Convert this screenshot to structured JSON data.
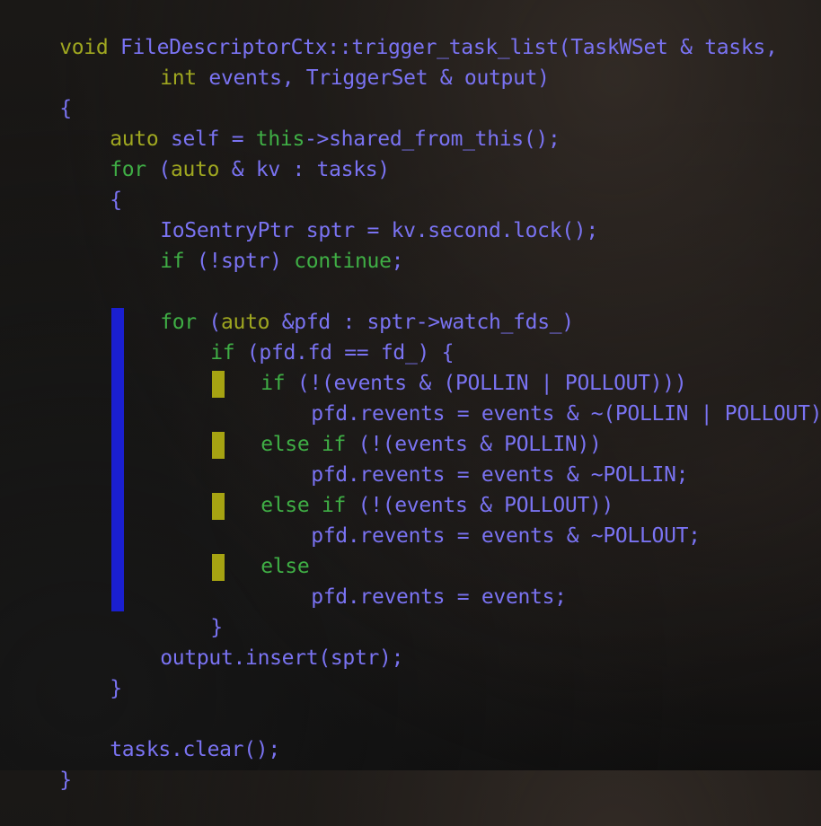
{
  "code": {
    "l1": {
      "t1": "void ",
      "t2": "FileDescriptorCtx::trigger_task_list(TaskWSet & tasks,"
    },
    "l2": {
      "t1": "int ",
      "t2": "events, TriggerSet & output)"
    },
    "l3": {
      "t2": "{"
    },
    "l4": {
      "t1": "auto ",
      "t2": "self = ",
      "t3": "this",
      "t4": "->shared_from_this();"
    },
    "l5": {
      "t1": "for ",
      "t2": "(",
      "t3": "auto ",
      "t4": "& kv : tasks)"
    },
    "l6": {
      "t2": "{"
    },
    "l7": {
      "t2": "IoSentryPtr sptr = kv.second.lock();"
    },
    "l8": {
      "t1": "if ",
      "t2": "(!sptr) ",
      "t3": "continue",
      "t4": ";"
    },
    "l9": {
      "t1": "for ",
      "t2": "(",
      "t3": "auto ",
      "t4": "&pfd : sptr->watch_fds_)"
    },
    "l10": {
      "t1": "if ",
      "t2": "(pfd.fd == fd_) {"
    },
    "l11": {
      "t1": "if ",
      "t2": "(!(events & (POLLIN | POLLOUT)))"
    },
    "l12": {
      "t2": "pfd.revents = events & ~(POLLIN | POLLOUT);"
    },
    "l13": {
      "t1": "else if ",
      "t2": "(!(events & POLLIN))"
    },
    "l14": {
      "t2": "pfd.revents = events & ~POLLIN;"
    },
    "l15": {
      "t1": "else if ",
      "t2": "(!(events & POLLOUT))"
    },
    "l16": {
      "t2": "pfd.revents = events & ~POLLOUT;"
    },
    "l17": {
      "t1": "else"
    },
    "l18": {
      "t2": "pfd.revents = events;"
    },
    "l19": {
      "t2": "}"
    },
    "l20": {
      "t2": "output.insert(sptr);"
    },
    "l21": {
      "t2": "}"
    },
    "l22": {
      "t2": "tasks.clear();"
    },
    "l23": {
      "t2": "}"
    }
  },
  "colors": {
    "keyword_yellow": "#9fa720",
    "keyword_green": "#3fae45",
    "identifier": "#7a73f2",
    "indent_guide_blue": "#1a1fd0",
    "indent_guide_yellow": "#a6a312"
  }
}
